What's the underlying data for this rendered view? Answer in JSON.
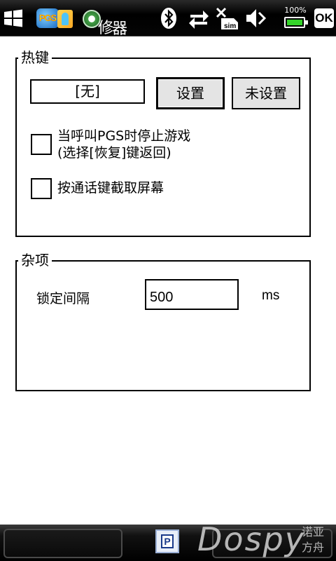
{
  "status_bar": {
    "app_icon_text": "PGS",
    "app_title_prefix": "修",
    "app_title": "器",
    "battery_text": "100%",
    "battery_level": 1.0,
    "ok_label": "OK",
    "icons": [
      "windows-start-icon",
      "bluetooth-icon",
      "data-transfer-icon",
      "no-sim-icon",
      "volume-muted-icon",
      "battery-icon"
    ],
    "battery_color": "#35d42a"
  },
  "hotkey_group": {
    "title": "热键",
    "current_hotkey": "[无]",
    "set_button": "设置",
    "unset_button": "未设置",
    "stop_game_checkbox": {
      "checked": false,
      "label_line1": "当呼叫PGS时停止游戏",
      "label_line2": "(选择[恢复]键返回)"
    },
    "screenshot_checkbox": {
      "checked": false,
      "label": "按通话键截取屏幕"
    }
  },
  "misc_group": {
    "title": "杂项",
    "lock_interval_label": "锁定间隔",
    "lock_interval_value": "500",
    "lock_interval_unit": "ms"
  },
  "bottom_bar": {
    "sip_icon_text": "P",
    "watermark": "Dospy",
    "watermark_cn_line1": "诺亚",
    "watermark_cn_line2": "方舟"
  }
}
